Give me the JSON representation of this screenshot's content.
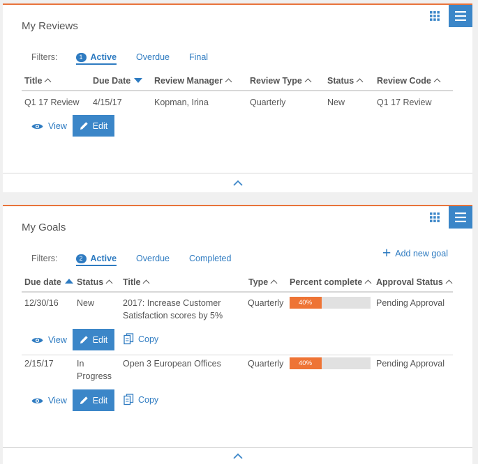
{
  "reviews": {
    "title": "My Reviews",
    "filters_label": "Filters:",
    "filters": [
      {
        "label": "Active",
        "badge": "1",
        "active": true
      },
      {
        "label": "Overdue"
      },
      {
        "label": "Final"
      }
    ],
    "columns": [
      "Title",
      "Due Date",
      "Review Manager",
      "Review Type",
      "Status",
      "Review Code"
    ],
    "rows": [
      {
        "title": "Q1 17 Review",
        "due_date": "4/15/17",
        "manager": "Kopman, Irina",
        "type": "Quarterly",
        "status": "New",
        "code": "Q1 17 Review",
        "view_label": "View",
        "edit_label": "Edit"
      }
    ]
  },
  "goals": {
    "title": "My Goals",
    "filters_label": "Filters:",
    "filters": [
      {
        "label": "Active",
        "badge": "2",
        "active": true
      },
      {
        "label": "Overdue"
      },
      {
        "label": "Completed"
      }
    ],
    "add_goal_label": "Add new goal",
    "columns": [
      "Due date",
      "Status",
      "Title",
      "Type",
      "Percent complete",
      "Approval Status"
    ],
    "rows": [
      {
        "due_date": "12/30/16",
        "status": "New",
        "title": "2017: Increase Customer Satisfaction scores by 5%",
        "type": "Quarterly",
        "percent": 40,
        "percent_label": "40%",
        "approval": "Pending Approval",
        "view_label": "View",
        "edit_label": "Edit",
        "copy_label": "Copy"
      },
      {
        "due_date": "2/15/17",
        "status": "In Progress",
        "title": "Open 3 European Offices",
        "type": "Quarterly",
        "percent": 40,
        "percent_label": "40%",
        "approval": "Pending Approval",
        "view_label": "View",
        "edit_label": "Edit",
        "copy_label": "Copy"
      }
    ]
  },
  "colors": {
    "accent": "#3b86c8",
    "link": "#2e7bc1",
    "progress": "#ee7435",
    "panel_top": "#e8733a"
  },
  "icons": [
    "grid-icon",
    "menu-icon",
    "eye-icon",
    "pencil-icon",
    "copy-icon",
    "plus-icon",
    "chevron-up-icon"
  ]
}
